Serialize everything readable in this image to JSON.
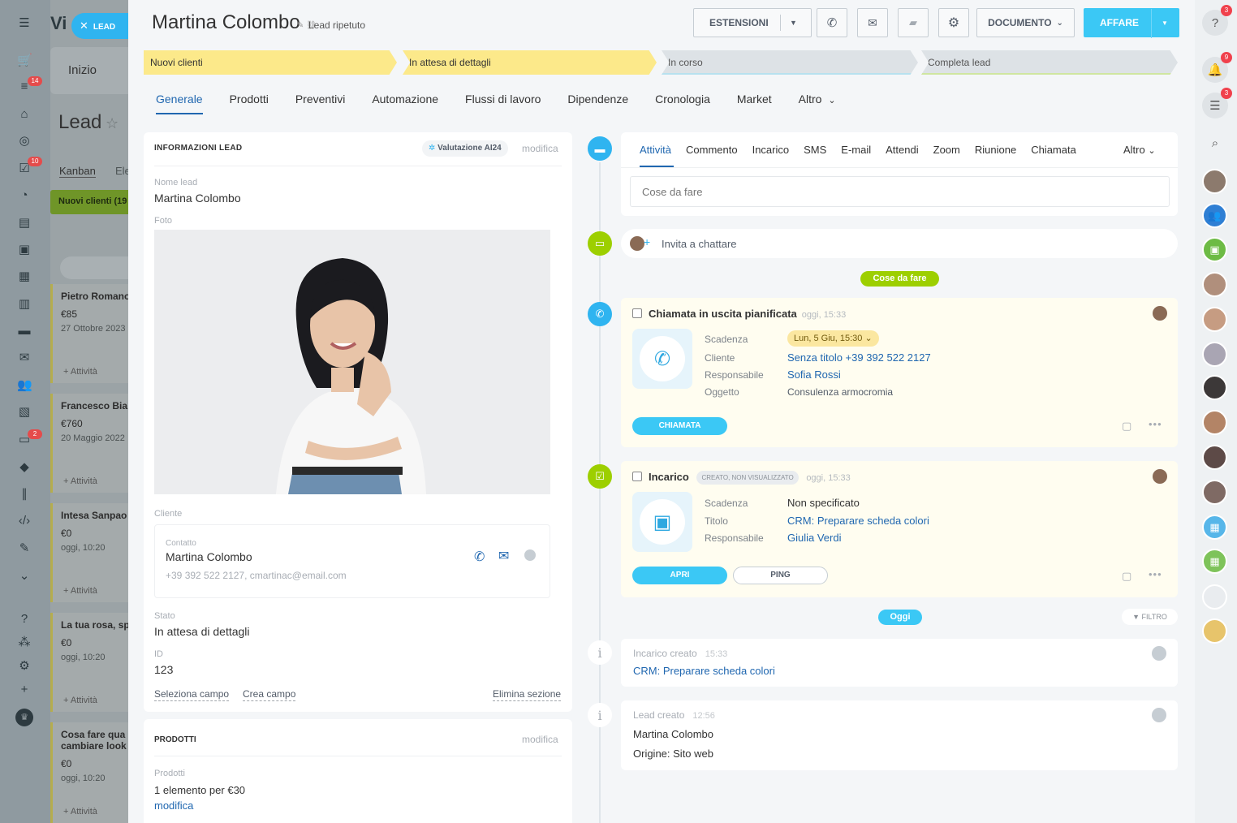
{
  "sidebar": {
    "badges": [
      "14",
      "10",
      "2"
    ],
    "icons": [
      "menu-icon",
      "cart-icon",
      "funnel-icon",
      "building-icon",
      "target-icon",
      "tasks-icon",
      "chart-icon",
      "card-icon",
      "chat-icon",
      "calendar-icon",
      "document-icon",
      "storage-icon",
      "mail-icon",
      "people-icon",
      "contact-card-icon",
      "robot-icon",
      "box-icon",
      "sign-icon",
      "code-icon",
      "pen-icon",
      "circle-down-icon",
      "help-icon",
      "sitemap-icon",
      "settings-icon",
      "plus-icon",
      "crown-icon"
    ]
  },
  "background": {
    "app_title": "Vi",
    "lead_tag": "LEAD",
    "home": "Inizio",
    "section_title": "Lead",
    "view_kanban": "Kanban",
    "view_other": "Ele",
    "column_header": "Nuovi clienti (19",
    "cards": [
      {
        "name": "Pietro Romano",
        "price": "€85",
        "date": "27 Ottobre 2023",
        "activity": "+ Attività"
      },
      {
        "name": "Francesco Bia",
        "price": "€760",
        "date": "20 Maggio 2022",
        "activity": "+ Attività"
      },
      {
        "name": "Intesa Sanpao",
        "price": "€0",
        "date": "oggi, 10:20",
        "activity": "+ Attività"
      },
      {
        "name": "La tua rosa, sp",
        "price": "€0",
        "date": "oggi, 10:20",
        "activity": "+ Attività"
      },
      {
        "name": "Cosa fare qua",
        "name2": "cambiare look",
        "price": "€0",
        "date": "oggi, 10:20",
        "activity": "+ Attività"
      }
    ]
  },
  "header": {
    "title": "Martina Colombo",
    "repeat_label": "Lead ripetuto",
    "extensions": "ESTENSIONI",
    "document": "DOCUMENTO",
    "deal": "AFFARE"
  },
  "stages": [
    "Nuovi clienti",
    "In attesa di dettagli",
    "In corso",
    "Completa lead"
  ],
  "tabs": [
    "Generale",
    "Prodotti",
    "Preventivi",
    "Automazione",
    "Flussi di lavoro",
    "Dipendenze",
    "Cronologia",
    "Market",
    "Altro"
  ],
  "lead_info": {
    "section_title": "INFORMAZIONI LEAD",
    "ai_button": "Valutazione AI24",
    "edit": "modifica",
    "name_label": "Nome lead",
    "name_value": "Martina Colombo",
    "photo_label": "Foto",
    "client_label": "Cliente",
    "contact_label": "Contatto",
    "contact_name": "Martina Colombo",
    "contact_details": "+39 392 522 2127, cmartinac@email.com",
    "status_label": "Stato",
    "status_value": "In attesa di dettagli",
    "id_label": "ID",
    "id_value": "123",
    "select_field": "Seleziona campo",
    "create_field": "Crea campo",
    "delete_section": "Elimina sezione"
  },
  "products": {
    "section_title": "PRODOTTI",
    "edit": "modifica",
    "label": "Prodotti",
    "value": "1 elemento per €30",
    "link": "modifica"
  },
  "timeline": {
    "tabs": [
      "Attività",
      "Commento",
      "Incarico",
      "SMS",
      "E-mail",
      "Attendi",
      "Zoom",
      "Riunione",
      "Chiamata",
      "Altro"
    ],
    "todo_placeholder": "Cose da fare",
    "invite_chat": "Invita a chattare",
    "todo_pill": "Cose da fare",
    "today_pill": "Oggi",
    "filter": "FILTRO",
    "call": {
      "title": "Chiamata in uscita pianificata",
      "time": "oggi, 15:33",
      "deadline_label": "Scadenza",
      "deadline_value": "Lun, 5 Giu, 15:30",
      "client_label": "Cliente",
      "client_value": "Senza titolo +39 392 522 2127",
      "owner_label": "Responsabile",
      "owner_value": "Sofia Rossi",
      "subject_label": "Oggetto",
      "subject_value": "Consulenza armocromia",
      "button": "CHIAMATA"
    },
    "task": {
      "title": "Incarico",
      "status": "CREATO, NON VISUALIZZATO",
      "time": "oggi, 15:33",
      "deadline_label": "Scadenza",
      "deadline_value": "Non specificato",
      "title_label": "Titolo",
      "title_value": "CRM: Preparare scheda colori",
      "owner_label": "Responsabile",
      "owner_value": "Giulia Verdi",
      "open_button": "APRI",
      "ping_button": "PING"
    },
    "history": [
      {
        "heading": "Incarico creato",
        "time": "15:33",
        "line1": "CRM: Preparare scheda colori"
      },
      {
        "heading": "Lead creato",
        "time": "12:56",
        "line1": "Martina Colombo",
        "line2": "Origine: Sito web"
      }
    ]
  },
  "right_panel": {
    "badges": [
      "3",
      "9",
      "3"
    ]
  },
  "colors": {
    "accent": "#2fb4f0",
    "stage_yellow": "#fce98a",
    "stage_gray": "#dde2e6",
    "link": "#2067b0",
    "green": "#9dcf00"
  }
}
